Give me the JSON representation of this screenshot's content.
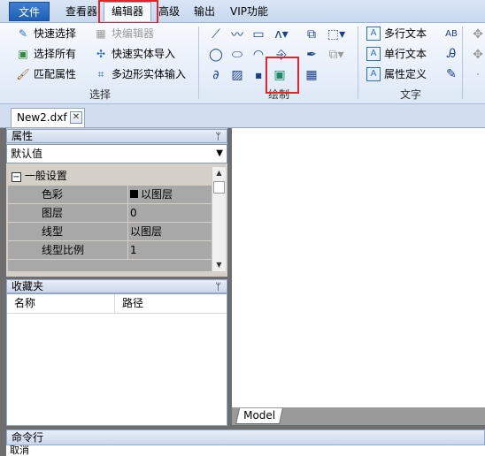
{
  "menu": {
    "file": "文件",
    "viewer": "查看器",
    "editor": "编辑器",
    "advanced": "高级",
    "output": "输出",
    "vip": "VIP功能"
  },
  "ribbon": {
    "select_group": {
      "label": "选择",
      "quick_select": "快速选择",
      "block_editor": "块编辑器",
      "select_all": "选择所有",
      "quick_import": "快速实体导入",
      "match_props": "匹配属性",
      "polygon_input": "多边形实体输入"
    },
    "draw_group": {
      "label": "绘制"
    },
    "text_group": {
      "label": "文字",
      "multiline": "多行文本",
      "singleline": "单行文本",
      "attr_def": "属性定义"
    }
  },
  "tabs": {
    "document": "New2.dxf",
    "close": "✕"
  },
  "properties": {
    "title": "属性",
    "pin": "ᛘ",
    "selected": "默认值",
    "section": "一般设置",
    "rows": [
      {
        "key": "色彩",
        "value": "以图层"
      },
      {
        "key": "图层",
        "value": "0"
      },
      {
        "key": "线型",
        "value": "以图层"
      },
      {
        "key": "线型比例",
        "value": "1"
      }
    ]
  },
  "favorites": {
    "title": "收藏夹",
    "col_name": "名称",
    "col_path": "路径"
  },
  "canvas": {
    "model_tab": "Model"
  },
  "command": {
    "title": "命令行",
    "text": "取消"
  },
  "colors": {
    "accent": "#1f5fb4",
    "highlight": "#e0262a",
    "ribbon": "#dde8f6"
  }
}
